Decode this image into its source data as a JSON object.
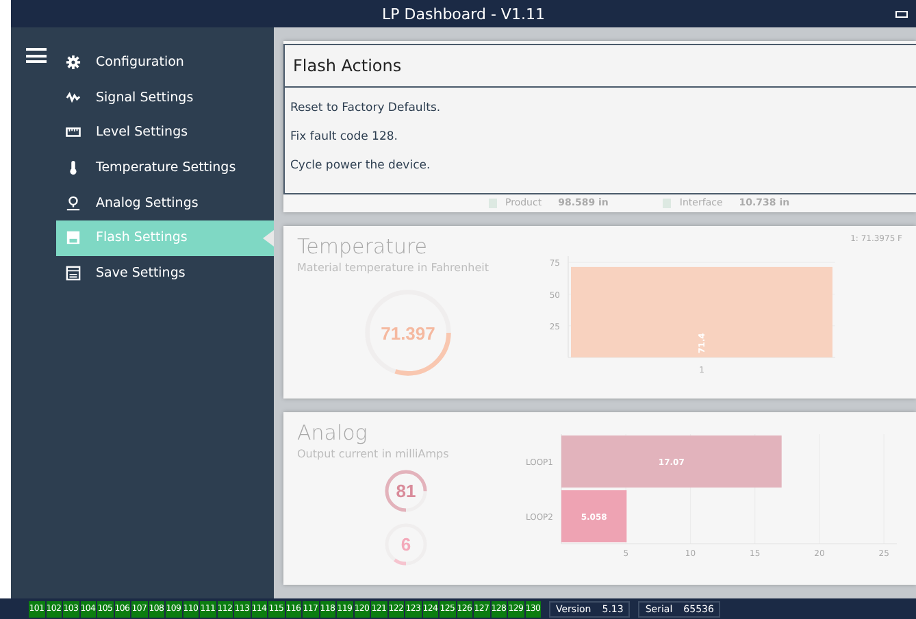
{
  "window": {
    "title": "LP Dashboard - V1.11"
  },
  "sidebar": {
    "items": [
      {
        "label": "Configuration",
        "selected": false
      },
      {
        "label": "Signal Settings",
        "selected": false
      },
      {
        "label": "Level Settings",
        "selected": false
      },
      {
        "label": "Temperature Settings",
        "selected": false
      },
      {
        "label": "Analog Settings",
        "selected": false
      },
      {
        "label": "Flash Settings",
        "selected": true
      },
      {
        "label": "Save Settings",
        "selected": false
      }
    ]
  },
  "level_card": {
    "legend": [
      {
        "name": "Product",
        "value": "98.589 in"
      },
      {
        "name": "Interface",
        "value": "10.738 in"
      }
    ]
  },
  "dialog": {
    "title": "Flash Actions",
    "lines": [
      "Reset to Factory Defaults.",
      "Fix fault code 128.",
      "Cycle power the device."
    ]
  },
  "temperature": {
    "title": "Temperature",
    "subtitle": "Material temperature in Fahrenheit",
    "gauge": {
      "value": "71.397",
      "level": 0.3
    },
    "legend": "1: 71.3975 F",
    "chart_data": {
      "type": "bar",
      "categories": [
        "1"
      ],
      "values": [
        71.4
      ],
      "ylim": [
        0,
        80
      ],
      "yticks": [
        25,
        50,
        75
      ],
      "grid": true,
      "data_labels": true
    }
  },
  "analog": {
    "title": "Analog",
    "subtitle": "Output current in milliAmps",
    "gauges": [
      {
        "value": "81",
        "level": 0.75
      },
      {
        "value": "6",
        "level": 0.1
      }
    ],
    "chart_data": {
      "type": "bar",
      "orientation": "horizontal",
      "categories": [
        "LOOP1",
        "LOOP2"
      ],
      "values": [
        17.07,
        5.058
      ],
      "value_labels": [
        "17.07",
        "5.058"
      ],
      "xlim": [
        0,
        26
      ],
      "xticks": [
        5,
        10,
        15,
        20,
        25
      ],
      "grid": true
    }
  },
  "status_bar": {
    "codes": [
      "101",
      "102",
      "103",
      "104",
      "105",
      "106",
      "107",
      "108",
      "109",
      "110",
      "111",
      "112",
      "113",
      "114",
      "115",
      "116",
      "117",
      "118",
      "119",
      "120",
      "121",
      "122",
      "123",
      "124",
      "125",
      "126",
      "127",
      "128",
      "129",
      "130"
    ],
    "version_label": "Version",
    "version": "5.13",
    "serial_label": "Serial",
    "serial": "65536"
  }
}
